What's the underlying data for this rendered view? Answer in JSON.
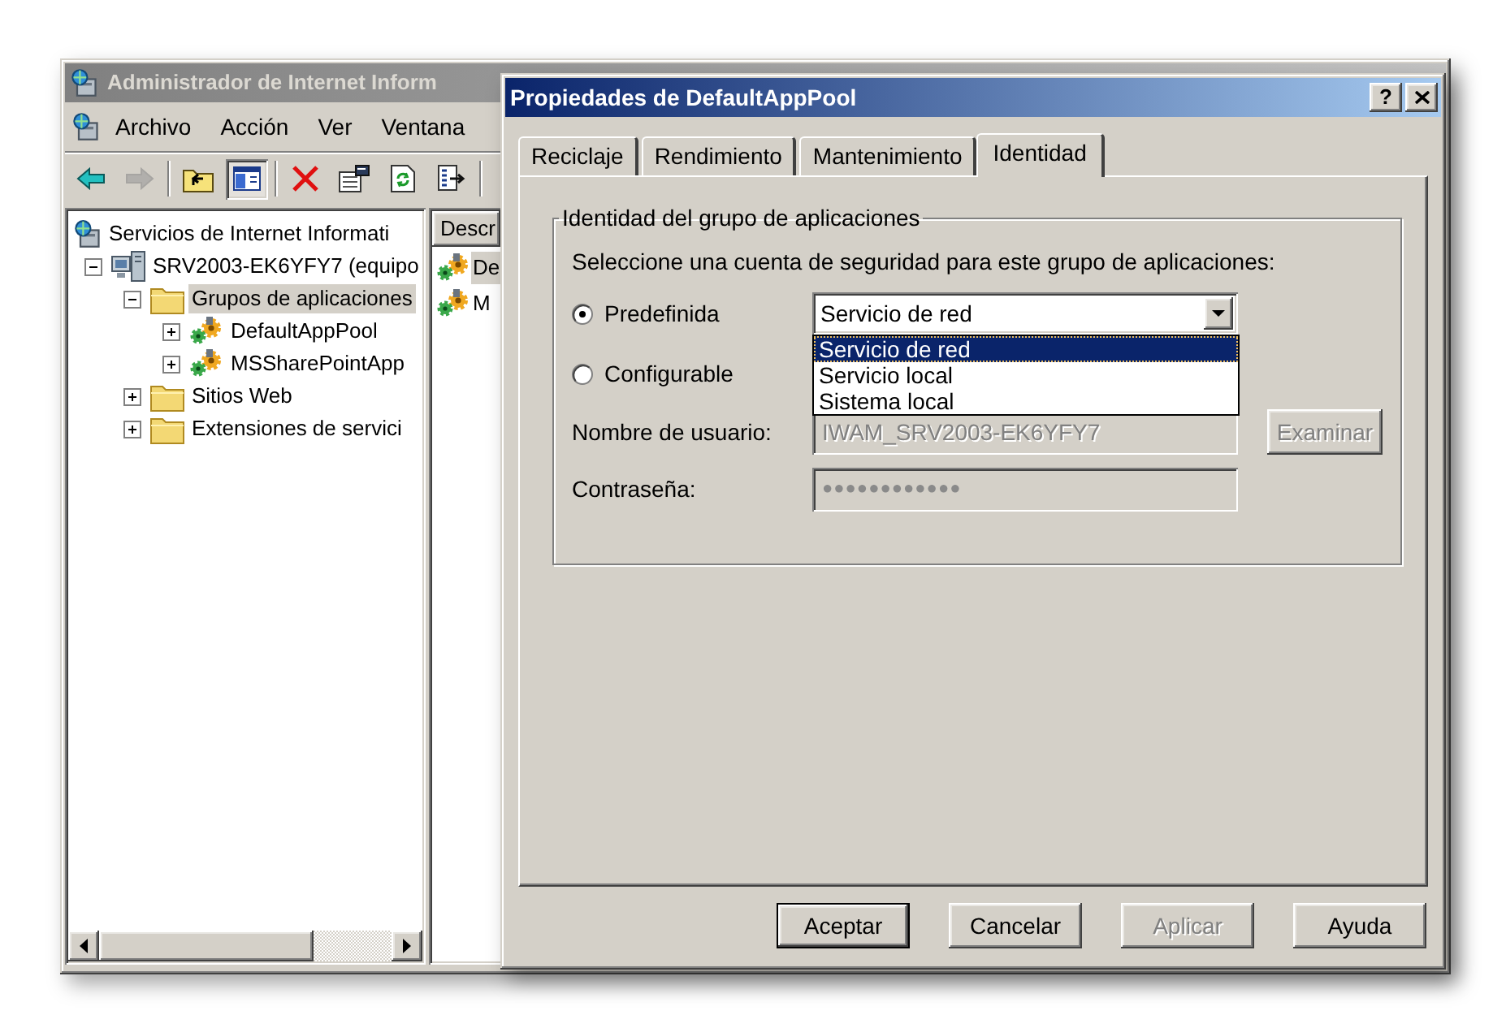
{
  "console": {
    "title": "Administrador de Internet Inform",
    "menu": [
      "Archivo",
      "Acción",
      "Ver",
      "Ventana"
    ],
    "toolbar": [
      {
        "kind": "back",
        "disabled": false,
        "pressed": false
      },
      {
        "kind": "forward",
        "disabled": true,
        "pressed": false
      },
      {
        "kind": "separator"
      },
      {
        "kind": "up",
        "disabled": false,
        "pressed": false
      },
      {
        "kind": "show_tree",
        "disabled": false,
        "pressed": true
      },
      {
        "kind": "separator"
      },
      {
        "kind": "delete",
        "disabled": false,
        "pressed": false
      },
      {
        "kind": "properties",
        "disabled": false,
        "pressed": false
      },
      {
        "kind": "refresh",
        "disabled": false,
        "pressed": false
      },
      {
        "kind": "export",
        "disabled": false,
        "pressed": false
      },
      {
        "kind": "separator"
      }
    ],
    "tree": [
      {
        "label": "Servicios de Internet Informati",
        "kind": "services",
        "selected": false,
        "children": [
          {
            "label": "SRV2003-EK6YFY7 (equipo",
            "kind": "server",
            "expanded": true,
            "selected": false,
            "children": [
              {
                "label": "Grupos de aplicaciones",
                "kind": "folder",
                "expanded": true,
                "selected": true,
                "children": [
                  {
                    "label": "DefaultAppPool",
                    "kind": "app_pool",
                    "expanded": false,
                    "selected": false
                  },
                  {
                    "label": "MSSharePointApp",
                    "kind": "app_pool",
                    "expanded": false,
                    "selected": false
                  }
                ]
              },
              {
                "label": "Sitios Web",
                "kind": "folder",
                "expanded": false,
                "selected": false
              },
              {
                "label": "Extensiones de servici",
                "kind": "folder",
                "expanded": false,
                "selected": false
              }
            ]
          }
        ]
      }
    ],
    "list": {
      "columns": [
        "Descr"
      ],
      "rows": [
        {
          "label": "De",
          "kind": "app_pool",
          "selected": true
        },
        {
          "label": "M",
          "kind": "app_pool",
          "selected": false
        }
      ]
    }
  },
  "dialog": {
    "title": "Propiedades de DefaultAppPool",
    "help_button": "?",
    "tabs": [
      {
        "label": "Reciclaje",
        "selected": false
      },
      {
        "label": "Rendimiento",
        "selected": false
      },
      {
        "label": "Mantenimiento",
        "selected": false
      },
      {
        "label": "Identidad",
        "selected": true
      }
    ],
    "group": {
      "legend": "Identidad del grupo de aplicaciones",
      "instruction": "Seleccione una cuenta de seguridad para este grupo de aplicaciones:",
      "options": [
        {
          "label": "Predefinida",
          "selected": true
        },
        {
          "label": "Configurable",
          "selected": false
        }
      ],
      "predefined_account": {
        "value": "Servicio de red",
        "expanded": true,
        "options": [
          {
            "label": "Servicio de red",
            "selected": true
          },
          {
            "label": "Servicio local",
            "selected": false
          },
          {
            "label": "Sistema local",
            "selected": false
          }
        ]
      },
      "username": {
        "label": "Nombre de usuario:",
        "value": "IWAM_SRV2003-EK6YFY7",
        "disabled": true
      },
      "browse_button": {
        "label": "Examinar",
        "disabled": true
      },
      "password": {
        "label": "Contraseña:",
        "value": "●●●●●●●●●●●●",
        "disabled": true
      }
    },
    "buttons": [
      {
        "label": "Aceptar",
        "default": true,
        "disabled": false
      },
      {
        "label": "Cancelar",
        "default": false,
        "disabled": false
      },
      {
        "label": "Aplicar",
        "default": false,
        "disabled": true
      },
      {
        "label": "Ayuda",
        "default": false,
        "disabled": false
      }
    ]
  }
}
